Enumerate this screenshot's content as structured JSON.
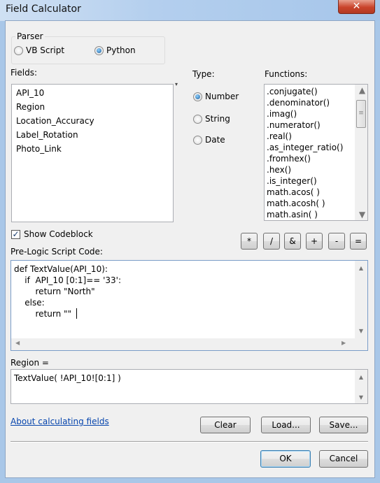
{
  "window": {
    "title": "Field Calculator",
    "close_icon": "close-icon"
  },
  "parser": {
    "label": "Parser",
    "options": [
      {
        "label": "VB Script",
        "selected": false
      },
      {
        "label": "Python",
        "selected": true
      }
    ]
  },
  "fields": {
    "label": "Fields:",
    "items": [
      "API_10",
      "Region",
      "Location_Accuracy",
      "Label_Rotation",
      "Photo_Link"
    ]
  },
  "type": {
    "label": "Type:",
    "options": [
      {
        "label": "Number",
        "selected": true
      },
      {
        "label": "String",
        "selected": false
      },
      {
        "label": "Date",
        "selected": false
      }
    ]
  },
  "functions": {
    "label": "Functions:",
    "items": [
      ".conjugate()",
      ".denominator()",
      ".imag()",
      ".numerator()",
      ".real()",
      ".as_integer_ratio()",
      ".fromhex()",
      ".hex()",
      ".is_integer()",
      "math.acos( )",
      "math.acosh( )",
      "math.asin( )"
    ]
  },
  "show_codeblock": {
    "label": "Show Codeblock",
    "checked": true
  },
  "operators": [
    "*",
    "/",
    "&",
    "+",
    "-",
    "="
  ],
  "prelogic": {
    "label": "Pre-Logic Script Code:",
    "code": "def TextValue(API_10):\n    if  API_10 [0:1]== '33':\n        return \"North\"\n    else:\n        return \"\""
  },
  "expression": {
    "label": "Region =",
    "value": "TextValue( !API_10![0:1] )"
  },
  "links": {
    "about": "About calculating fields"
  },
  "buttons": {
    "clear": "Clear",
    "load": "Load...",
    "save": "Save...",
    "ok": "OK",
    "cancel": "Cancel"
  }
}
